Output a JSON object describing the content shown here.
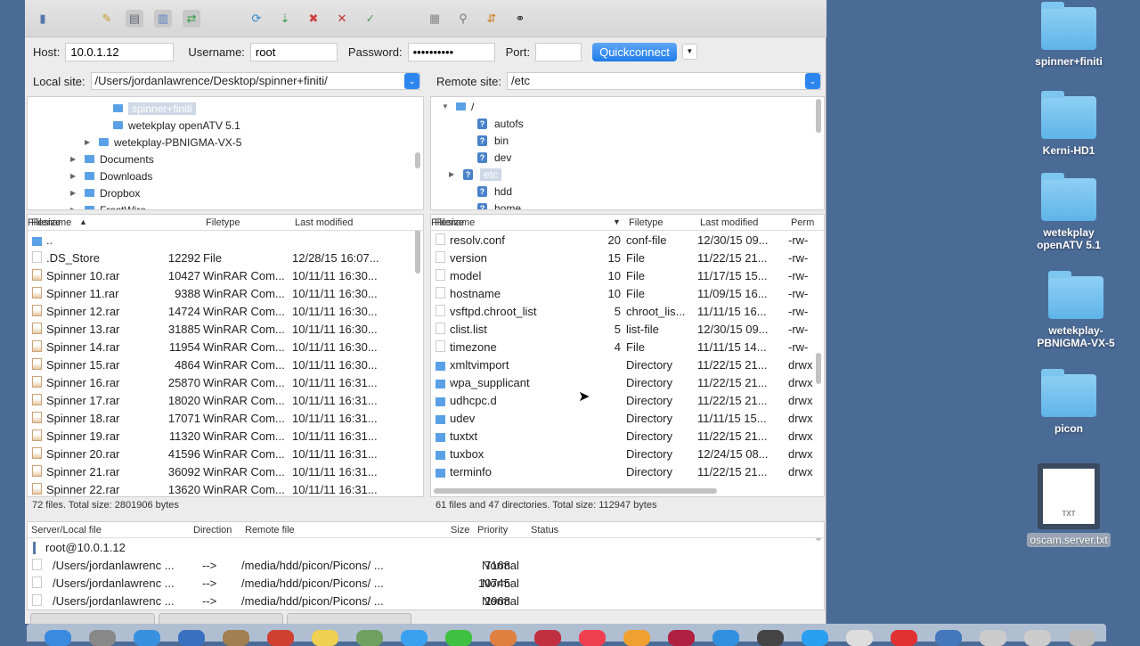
{
  "toolbar": {
    "icons": [
      "site-manager-icon",
      "message-log-icon",
      "toggle-local-tree-icon",
      "toggle-remote-tree-icon",
      "toggle-queue-icon",
      "refresh-icon",
      "process-queue-icon",
      "cancel-icon",
      "disconnect-icon",
      "reconnect-icon",
      "filter-icon",
      "compare-icon",
      "sync-browse-icon",
      "search-binoculars-icon"
    ]
  },
  "quickconnect": {
    "host_label": "Host:",
    "host": "10.0.1.12",
    "username_label": "Username:",
    "username": "root",
    "password_label": "Password:",
    "password": "••••••••••",
    "port_label": "Port:",
    "port": "",
    "button": "Quickconnect"
  },
  "local": {
    "label": "Local site:",
    "path": "/Users/jordanlawrence/Desktop/spinner+finiti/",
    "tree": [
      {
        "name": "spinner+finiti",
        "selected": true
      },
      {
        "name": "wetekplay openATV 5.1"
      },
      {
        "name": "wetekplay-PBNIGMA-VX-5"
      },
      {
        "name": "Documents"
      },
      {
        "name": "Downloads"
      },
      {
        "name": "Dropbox"
      },
      {
        "name": "FrostWire"
      }
    ],
    "columns": [
      "Filename",
      "Filesize",
      "Filetype",
      "Last modified"
    ],
    "files": [
      [
        "..",
        "",
        "",
        ""
      ],
      [
        ".DS_Store",
        "12292",
        "File",
        "12/28/15 16:07..."
      ],
      [
        "Spinner 10.rar",
        "10427",
        "WinRAR Com...",
        "10/11/11 16:30..."
      ],
      [
        "Spinner 11.rar",
        "9388",
        "WinRAR Com...",
        "10/11/11 16:30..."
      ],
      [
        "Spinner 12.rar",
        "14724",
        "WinRAR Com...",
        "10/11/11 16:30..."
      ],
      [
        "Spinner 13.rar",
        "31885",
        "WinRAR Com...",
        "10/11/11 16:30..."
      ],
      [
        "Spinner 14.rar",
        "11954",
        "WinRAR Com...",
        "10/11/11 16:30..."
      ],
      [
        "Spinner 15.rar",
        "4864",
        "WinRAR Com...",
        "10/11/11 16:30..."
      ],
      [
        "Spinner 16.rar",
        "25870",
        "WinRAR Com...",
        "10/11/11 16:31..."
      ],
      [
        "Spinner 17.rar",
        "18020",
        "WinRAR Com...",
        "10/11/11 16:31..."
      ],
      [
        "Spinner 18.rar",
        "17071",
        "WinRAR Com...",
        "10/11/11 16:31..."
      ],
      [
        "Spinner 19.rar",
        "11320",
        "WinRAR Com...",
        "10/11/11 16:31..."
      ],
      [
        "Spinner 20.rar",
        "41596",
        "WinRAR Com...",
        "10/11/11 16:31..."
      ],
      [
        "Spinner 21.rar",
        "36092",
        "WinRAR Com...",
        "10/11/11 16:31..."
      ],
      [
        "Spinner 22.rar",
        "13620",
        "WinRAR Com...",
        "10/11/11 16:31..."
      ]
    ],
    "status": "72 files. Total size: 2801906 bytes"
  },
  "remote": {
    "label": "Remote site:",
    "path": "/etc",
    "tree": [
      {
        "name": "/"
      },
      {
        "name": "autofs"
      },
      {
        "name": "bin"
      },
      {
        "name": "dev"
      },
      {
        "name": "etc",
        "selected": true
      },
      {
        "name": "hdd"
      },
      {
        "name": "home"
      }
    ],
    "columns": [
      "Filename",
      "Filesize",
      "Filetype",
      "Last modified",
      "Perm"
    ],
    "files": [
      [
        "resolv.conf",
        "20",
        "conf-file",
        "12/30/15 09...",
        "-rw-"
      ],
      [
        "version",
        "15",
        "File",
        "11/22/15 21...",
        "-rw-"
      ],
      [
        "model",
        "10",
        "File",
        "11/17/15 15...",
        "-rw-"
      ],
      [
        "hostname",
        "10",
        "File",
        "11/09/15 16...",
        "-rw-"
      ],
      [
        "vsftpd.chroot_list",
        "5",
        "chroot_lis...",
        "11/11/15 16...",
        "-rw-"
      ],
      [
        "clist.list",
        "5",
        "list-file",
        "12/30/15 09...",
        "-rw-"
      ],
      [
        "timezone",
        "4",
        "File",
        "11/11/15 14...",
        "-rw-"
      ],
      [
        "xmltvimport",
        "",
        "Directory",
        "11/22/15 21...",
        "drwx"
      ],
      [
        "wpa_supplicant",
        "",
        "Directory",
        "11/22/15 21...",
        "drwx"
      ],
      [
        "udhcpc.d",
        "",
        "Directory",
        "11/22/15 21...",
        "drwx"
      ],
      [
        "udev",
        "",
        "Directory",
        "11/11/15 15...",
        "drwx"
      ],
      [
        "tuxtxt",
        "",
        "Directory",
        "11/22/15 21...",
        "drwx"
      ],
      [
        "tuxbox",
        "",
        "Directory",
        "12/24/15 08...",
        "drwx"
      ],
      [
        "terminfo",
        "",
        "Directory",
        "11/22/15 21...",
        "drwx"
      ]
    ],
    "status": "61 files and 47 directories. Total size: 112947 bytes"
  },
  "queue": {
    "columns": [
      "Server/Local file",
      "Direction",
      "Remote file",
      "Size",
      "Priority",
      "Status"
    ],
    "server": "root@10.0.1.12",
    "items": [
      [
        "/Users/jordanlawrenc ...",
        "-->",
        "/media/hdd/picon/Picons/ ...",
        "7168",
        "Normal"
      ],
      [
        "/Users/jordanlawrenc ...",
        "-->",
        "/media/hdd/picon/Picons/ ...",
        "10745",
        "Normal"
      ],
      [
        "/Users/jordanlawrenc ...",
        "-->",
        "/media/hdd/picon/Picons/ ...",
        "2968",
        "Normal"
      ]
    ]
  },
  "desktop": [
    {
      "name": "spinner+finiti",
      "type": "folder"
    },
    {
      "name": "Kerni-HD1",
      "type": "folder"
    },
    {
      "name": "wetekplay openATV 5.1",
      "type": "folder"
    },
    {
      "name": "wetekplay-PBNIGMA-VX-5",
      "type": "folder"
    },
    {
      "name": "picon",
      "type": "folder"
    },
    {
      "name": "oscam.server.txt",
      "type": "txt",
      "badge": "TXT"
    }
  ]
}
